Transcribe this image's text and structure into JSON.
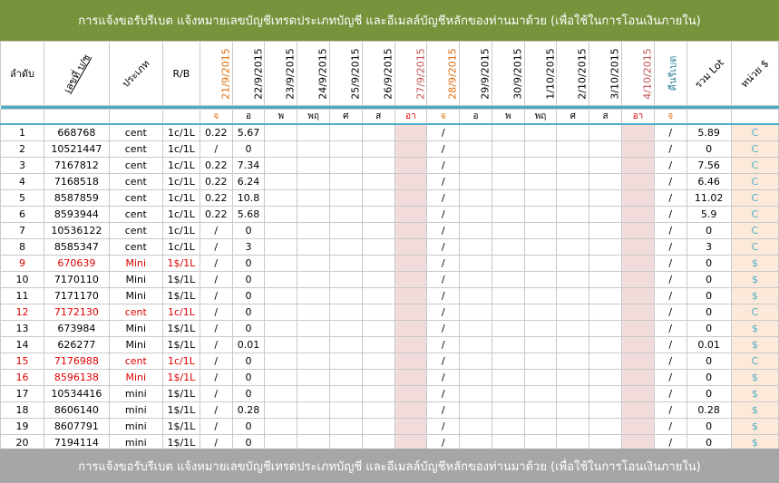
{
  "banner": {
    "top_text": "การแจ้งขอรับรีเบต   แจ้งหมายเลขบัญชีเทรดประเภทบัญชี และอีเมลล์บัญชีหลักของท่านมาด้วย   (เพื่อใช้ในการโอนเงินภายใน)",
    "bottom_text": "การแจ้งขอรับรีเบต   แจ้งหมายเลขบัญชีเทรดประเภทบัญชี และอีเมลล์บัญชีหลักของท่านมาด้วย   (เพื่อใช้ในการโอนเงินภายใน)"
  },
  "headers": {
    "index": "ลำดับ",
    "account": "เลขที่ บ/ช",
    "type": "ประเภท",
    "rb": "R/B",
    "cashback": "คืนรีเบต",
    "total_lot": "รวม Lot",
    "unit": "หน่วย $"
  },
  "dates": [
    "21/9/2015",
    "22/9/2015",
    "23/9/2015",
    "24/9/2015",
    "25/9/2015",
    "26/9/2015",
    "27/9/2015",
    "28/9/2015",
    "29/9/2015",
    "30/9/2015",
    "1/10/2015",
    "2/10/2015",
    "3/10/2015",
    "4/10/2015"
  ],
  "days": [
    "จ",
    "อ",
    "พ",
    "พฤ",
    "ศ",
    "ส",
    "อา",
    "จ",
    "อ",
    "พ",
    "พฤ",
    "ศ",
    "ส",
    "อา",
    "จ"
  ],
  "rows": [
    {
      "idx": "1",
      "acc": "668768",
      "type": "cent",
      "rb": "1c/1L",
      "d1": "0.22",
      "d2": "5.67",
      "cb": "/",
      "total": "5.89",
      "unit": "C",
      "hl": false
    },
    {
      "idx": "2",
      "acc": "10521447",
      "type": "cent",
      "rb": "1c/1L",
      "d1": "/",
      "d2": "0",
      "cb": "/",
      "total": "0",
      "unit": "C",
      "hl": false
    },
    {
      "idx": "3",
      "acc": "7167812",
      "type": "cent",
      "rb": "1c/1L",
      "d1": "0.22",
      "d2": "7.34",
      "cb": "/",
      "total": "7.56",
      "unit": "C",
      "hl": false
    },
    {
      "idx": "4",
      "acc": "7168518",
      "type": "cent",
      "rb": "1c/1L",
      "d1": "0.22",
      "d2": "6.24",
      "cb": "/",
      "total": "6.46",
      "unit": "C",
      "hl": false
    },
    {
      "idx": "5",
      "acc": "8587859",
      "type": "cent",
      "rb": "1c/1L",
      "d1": "0.22",
      "d2": "10.8",
      "cb": "/",
      "total": "11.02",
      "unit": "C",
      "hl": false
    },
    {
      "idx": "6",
      "acc": "8593944",
      "type": "cent",
      "rb": "1c/1L",
      "d1": "0.22",
      "d2": "5.68",
      "cb": "/",
      "total": "5.9",
      "unit": "C",
      "hl": false
    },
    {
      "idx": "7",
      "acc": "10536122",
      "type": "cent",
      "rb": "1c/1L",
      "d1": "/",
      "d2": "0",
      "cb": "/",
      "total": "0",
      "unit": "C",
      "hl": false
    },
    {
      "idx": "8",
      "acc": "8585347",
      "type": "cent",
      "rb": "1c/1L",
      "d1": "/",
      "d2": "3",
      "cb": "/",
      "total": "3",
      "unit": "C",
      "hl": false
    },
    {
      "idx": "9",
      "acc": "670639",
      "type": "Mini",
      "rb": "1$/1L",
      "d1": "/",
      "d2": "0",
      "cb": "/",
      "total": "0",
      "unit": "$",
      "hl": true
    },
    {
      "idx": "10",
      "acc": "7170110",
      "type": "Mini",
      "rb": "1$/1L",
      "d1": "/",
      "d2": "0",
      "cb": "/",
      "total": "0",
      "unit": "$",
      "hl": false
    },
    {
      "idx": "11",
      "acc": "7171170",
      "type": "Mini",
      "rb": "1$/1L",
      "d1": "/",
      "d2": "0",
      "cb": "/",
      "total": "0",
      "unit": "$",
      "hl": false
    },
    {
      "idx": "12",
      "acc": "7172130",
      "type": "cent",
      "rb": "1c/1L",
      "d1": "/",
      "d2": "0",
      "cb": "/",
      "total": "0",
      "unit": "C",
      "hl": true
    },
    {
      "idx": "13",
      "acc": "673984",
      "type": "Mini",
      "rb": "1$/1L",
      "d1": "/",
      "d2": "0",
      "cb": "/",
      "total": "0",
      "unit": "$",
      "hl": false
    },
    {
      "idx": "14",
      "acc": "626277",
      "type": "Mini",
      "rb": "1$/1L",
      "d1": "/",
      "d2": "0.01",
      "cb": "/",
      "total": "0.01",
      "unit": "$",
      "hl": false
    },
    {
      "idx": "15",
      "acc": "7176988",
      "type": "cent",
      "rb": "1c/1L",
      "d1": "/",
      "d2": "0",
      "cb": "/",
      "total": "0",
      "unit": "C",
      "hl": true
    },
    {
      "idx": "16",
      "acc": "8596138",
      "type": "Mini",
      "rb": "1$/1L",
      "d1": "/",
      "d2": "0",
      "cb": "/",
      "total": "0",
      "unit": "$",
      "hl": true
    },
    {
      "idx": "17",
      "acc": "10534416",
      "type": "mini",
      "rb": "1$/1L",
      "d1": "/",
      "d2": "0",
      "cb": "/",
      "total": "0",
      "unit": "$",
      "hl": false
    },
    {
      "idx": "18",
      "acc": "8606140",
      "type": "mini",
      "rb": "1$/1L",
      "d1": "/",
      "d2": "0.28",
      "cb": "/",
      "total": "0.28",
      "unit": "$",
      "hl": false
    },
    {
      "idx": "19",
      "acc": "8607791",
      "type": "mini",
      "rb": "1$/1L",
      "d1": "/",
      "d2": "0",
      "cb": "/",
      "total": "0",
      "unit": "$",
      "hl": false
    },
    {
      "idx": "20",
      "acc": "7194114",
      "type": "mini",
      "rb": "1$/1L",
      "d1": "/",
      "d2": "0",
      "cb": "/",
      "total": "0",
      "unit": "$",
      "hl": false
    }
  ],
  "row_slash_col8": "/",
  "colors": {
    "banner_top": "#77933c",
    "banner_bottom": "#a6a6a6",
    "accent": "#4bacc6",
    "highlight_red": "#e00000",
    "sunday_fill": "#f2dcdb",
    "unit_fill": "#fde9d9"
  }
}
